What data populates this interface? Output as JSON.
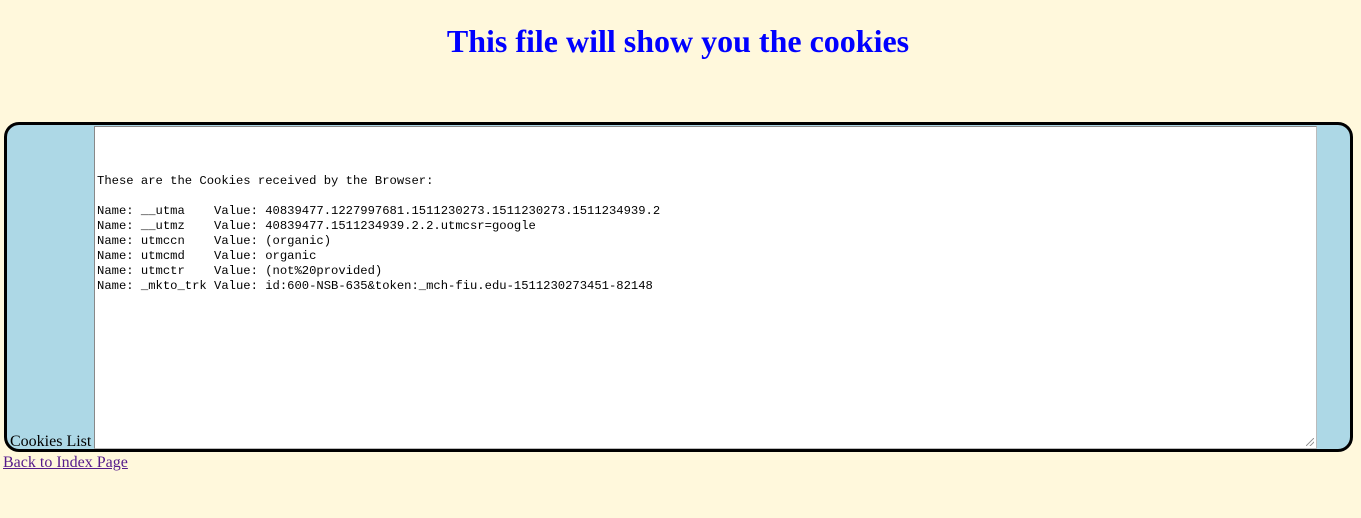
{
  "page_title": "This file will show you the cookies",
  "panel": {
    "label": "Cookies List",
    "intro": "These are the Cookies received by the Browser:",
    "cookies": [
      {
        "line": "Name: __utma    Value: 40839477.1227997681.1511230273.1511230273.1511234939.2"
      },
      {
        "line": "Name: __utmz    Value: 40839477.1511234939.2.2.utmcsr=google"
      },
      {
        "line": "Name: utmccn    Value: (organic)"
      },
      {
        "line": "Name: utmcmd    Value: organic"
      },
      {
        "line": "Name: utmctr    Value: (not%20provided)"
      },
      {
        "line": "Name: _mkto_trk Value: id:600-NSB-635&token:_mch-fiu.edu-1511230273451-82148"
      }
    ]
  },
  "back_link": "Back to Index Page",
  "colors": {
    "background": "#FFF8DC",
    "title": "#0000FF",
    "panel": "#ADD8E6",
    "visited_link": "#551A8B"
  }
}
